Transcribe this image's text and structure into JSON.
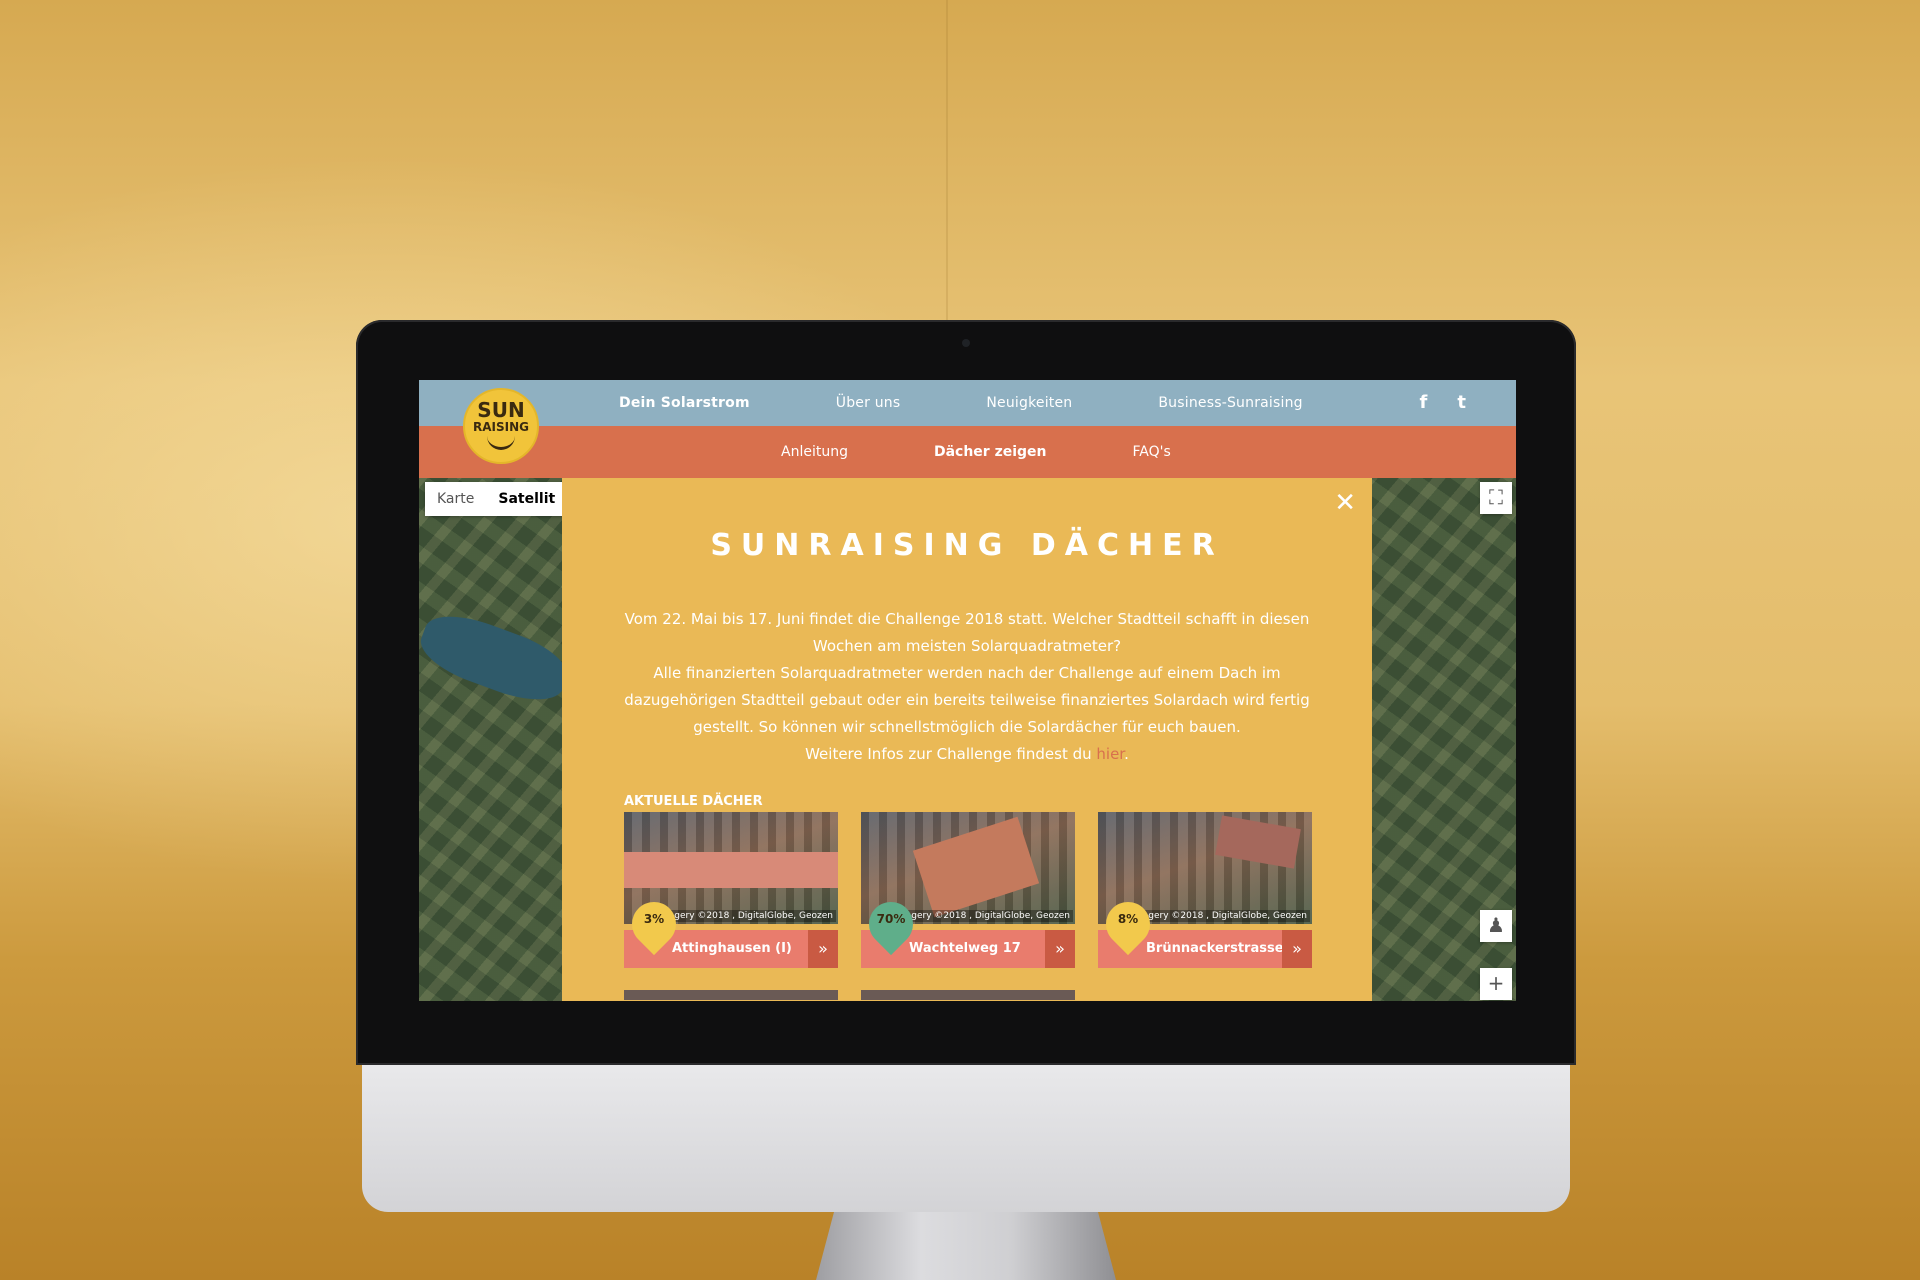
{
  "nav": {
    "top_items": [
      "Dein Solarstrom",
      "Über uns",
      "Neuigkeiten",
      "Business-Sunraising"
    ],
    "sub_items": [
      "Anleitung",
      "Dächer zeigen",
      "FAQ's"
    ],
    "social": {
      "facebook": "f",
      "twitter": "t"
    }
  },
  "logo": {
    "line1": "SUN",
    "line2": "RAISING"
  },
  "map": {
    "type_options": [
      "Karte",
      "Satellit"
    ],
    "fullscreen_glyph": "⛶",
    "pegman_glyph": "♟",
    "zoom_in_glyph": "+"
  },
  "panel": {
    "close_glyph": "✕",
    "title": "SUNRAISING DÄCHER",
    "paragraph_lines": [
      "Vom 22. Mai bis 17. Juni findet die Challenge 2018 statt. Welcher Stadtteil schafft in diesen",
      "Wochen am meisten Solarquadratmeter?",
      "Alle finanzierten Solarquadratmeter werden nach der Challenge auf einem Dach im",
      "dazugehörigen Stadtteil gebaut oder ein bereits teilweise finanziertes Solardach wird fertig",
      "gestellt. So können wir schnellstmöglich die Solardächer für euch bauen."
    ],
    "info_prefix": "Weitere Infos zur Challenge findest du ",
    "info_link": "hier",
    "info_suffix": ".",
    "section_label": "AKTUELLE DÄCHER",
    "go_glyph": "»",
    "roofs": [
      {
        "name": "Attinghausen (I)",
        "percent": "3%",
        "pin_color": "#f2c94c",
        "credit": "Imagery ©2018 , DigitalGlobe, Geozen"
      },
      {
        "name": "Wachtelweg 17",
        "percent": "70%",
        "pin_color": "#5fae8a",
        "credit": "Imagery ©2018 , DigitalGlobe, Geozen"
      },
      {
        "name": "Brünnackerstrasse",
        "percent": "8%",
        "pin_color": "#f2c94c",
        "credit": "Imagery ©2018 , DigitalGlobe, Geozen"
      }
    ]
  },
  "device": {
    "logo_glyph": ""
  }
}
